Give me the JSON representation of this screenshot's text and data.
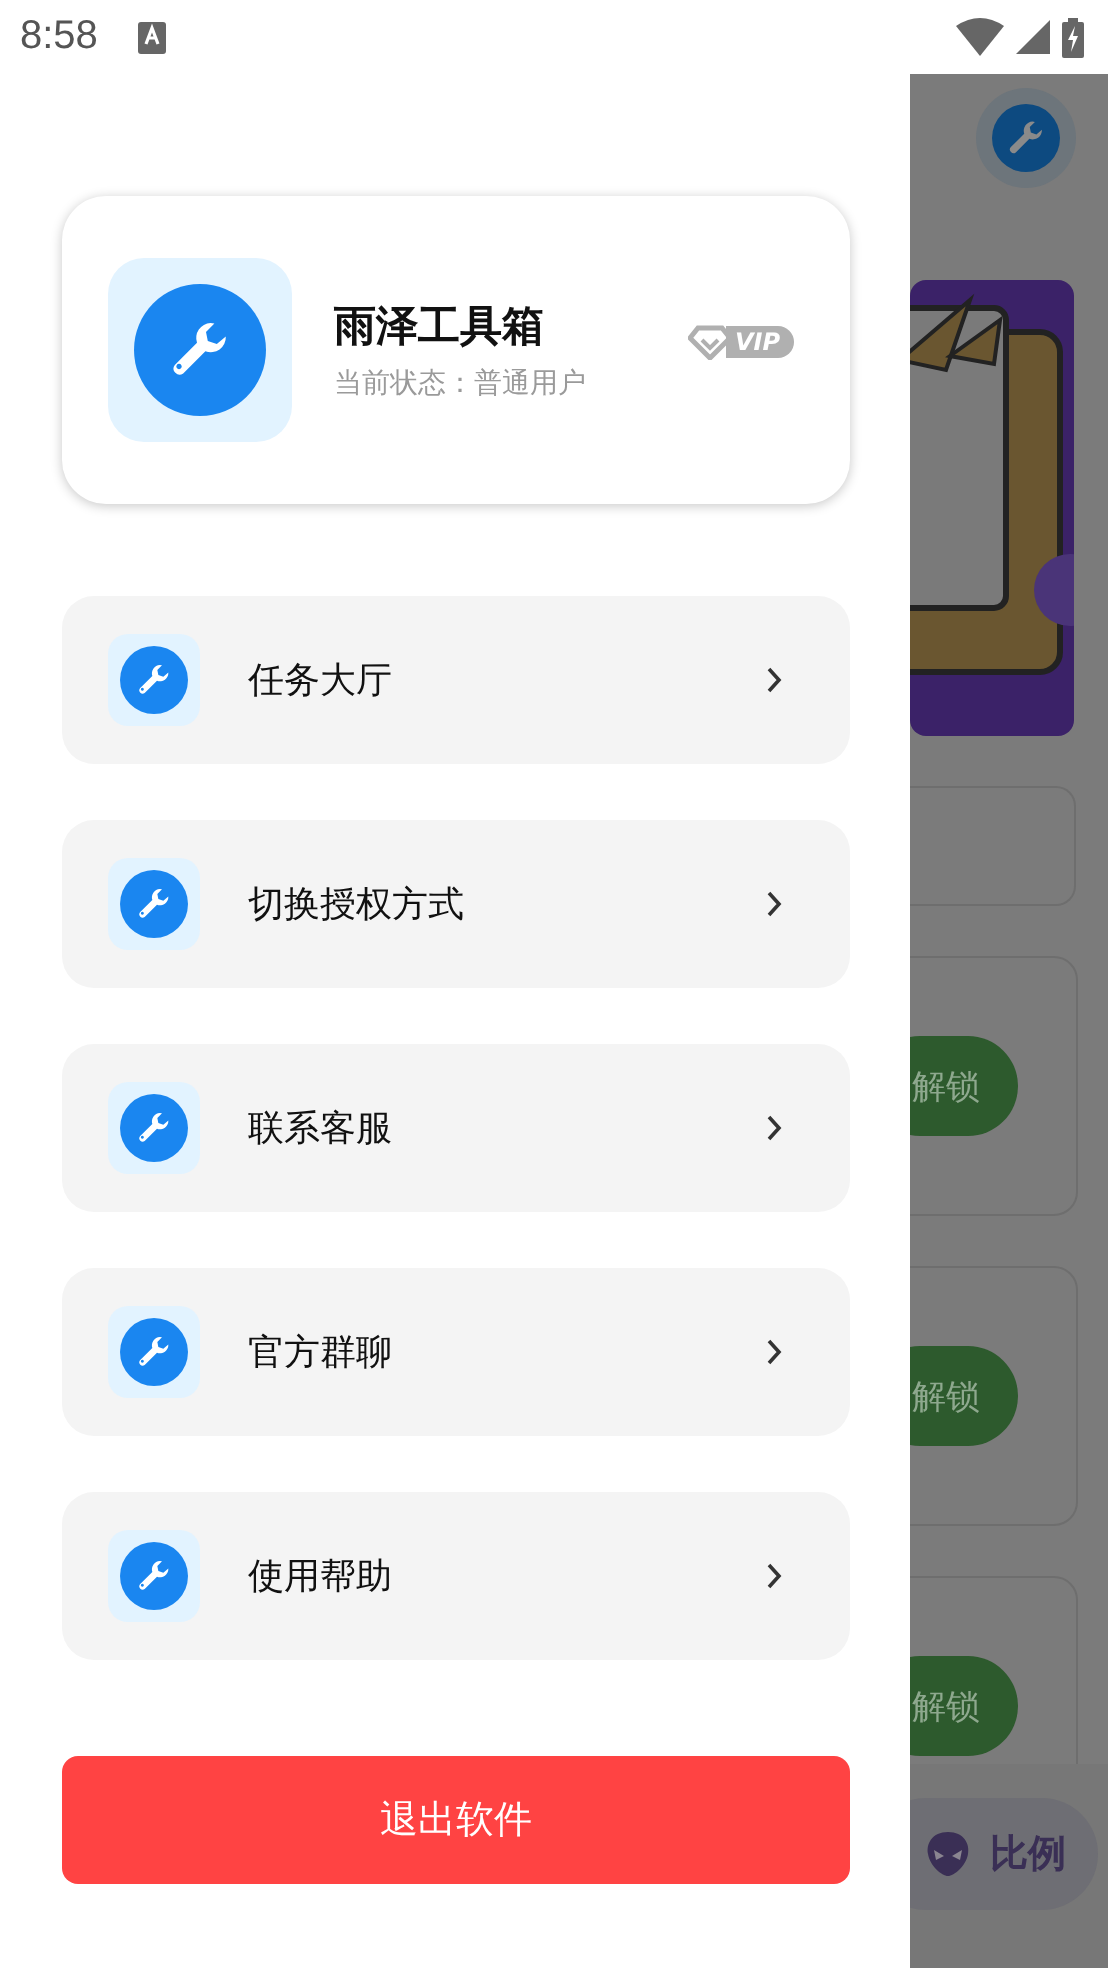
{
  "status_bar": {
    "time": "8:58"
  },
  "drawer": {
    "app_name": "雨泽工具箱",
    "status": "当前状态：普通用户",
    "badge": "VIP",
    "menu": [
      {
        "label": "任务大厅"
      },
      {
        "label": "切换授权方式"
      },
      {
        "label": "联系客服"
      },
      {
        "label": "官方群聊"
      },
      {
        "label": "使用帮助"
      }
    ],
    "exit_button": "退出软件"
  },
  "background_app": {
    "unlock_buttons": [
      "解锁",
      "解锁",
      "解锁"
    ],
    "ratio_button": "比例"
  }
}
